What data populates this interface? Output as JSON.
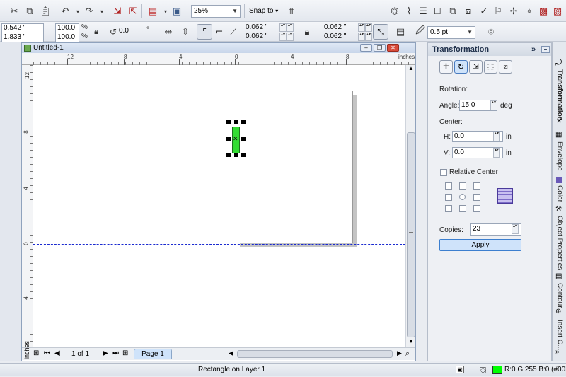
{
  "toolbar1": {
    "zoom": "25%",
    "snap_label": "Snap to",
    "icons": [
      "cut-icon",
      "copy-icon",
      "paste-icon",
      "undo-icon",
      "redo-icon",
      "import-icon",
      "export-icon",
      "publish-pdf-icon",
      "application-launcher-icon",
      "welcome-screen-icon",
      "options-icon"
    ]
  },
  "propbar": {
    "pos_x": "0.542 \"",
    "pos_y": "1.833 \"",
    "scale_x": "100.0",
    "scale_y": "100.0",
    "pct": "%",
    "angle": "0.0",
    "deg": "°",
    "corner_tl": "0.062 \"",
    "corner_bl": "0.062 \"",
    "corner_tr": "0.062 \"",
    "corner_br": "0.062 \"",
    "outline": "0.5 pt"
  },
  "document": {
    "title": "Untitled-1",
    "ruler_unit": "inches",
    "ruler_top": [
      "12",
      "8",
      "4",
      "0",
      "4",
      "8"
    ],
    "ruler_left": [
      "12",
      "8",
      "4",
      "0",
      "4"
    ],
    "page_nav": "1 of 1",
    "page_tab": "Page 1"
  },
  "docker": {
    "title": "Transformation",
    "section_rotation": "Rotation:",
    "angle_label": "Angle:",
    "angle_value": "15.0",
    "angle_unit": "deg",
    "center_label": "Center:",
    "h_label": "H:",
    "h_value": "0.0",
    "h_unit": "in",
    "v_label": "V:",
    "v_value": "0.0",
    "v_unit": "in",
    "relative_center": "Relative Center",
    "copies_label": "Copies:",
    "copies_value": "23",
    "apply_label": "Apply"
  },
  "side_tabs": [
    "Transformation",
    "Envelope",
    "Color",
    "Object Properties",
    "Contour",
    "Insert C..."
  ],
  "status": {
    "message": "Rectangle on Layer 1",
    "fill_color_hex": "#00ff00",
    "fill_readout": "R:0 G:255 B:0 (#00FF"
  },
  "colors": {
    "selected_fill": "#33dd33",
    "guide": "#1a2ad0",
    "apply_button": "#cfe3fa"
  }
}
